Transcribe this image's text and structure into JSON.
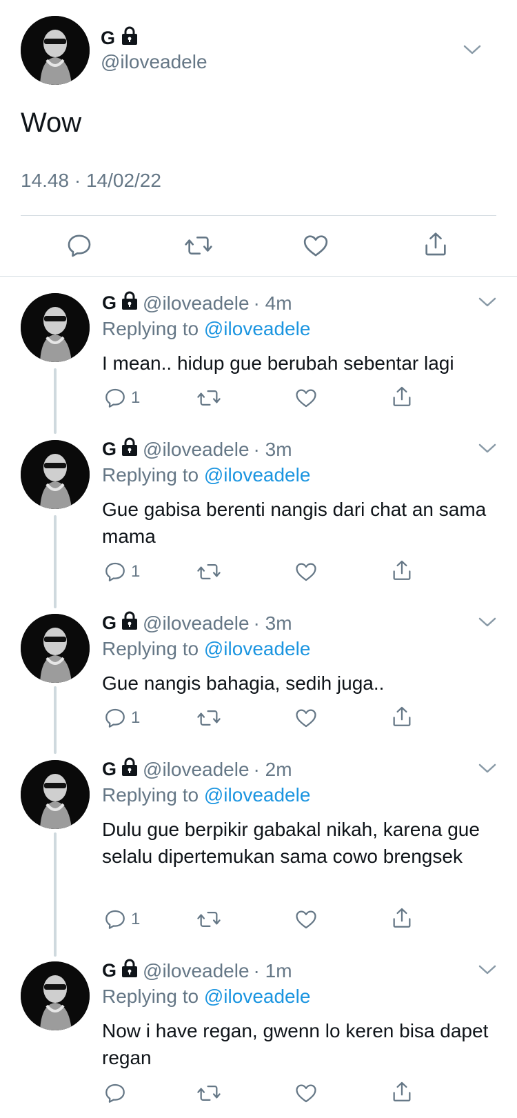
{
  "main_tweet": {
    "name": "G",
    "handle": "@iloveadele",
    "text": "Wow",
    "timestamp": "14.48 · 14/02/22",
    "icons": [
      "reply-icon",
      "retweet-icon",
      "like-icon",
      "share-icon"
    ]
  },
  "replies": [
    {
      "name": "G",
      "handle": "@iloveadele",
      "time": "· 4m",
      "replying_prefix": "Replying to",
      "replying_to": "@iloveadele",
      "text": "I mean.. hidup gue berubah sebentar lagi",
      "reply_count": "1"
    },
    {
      "name": "G",
      "handle": "@iloveadele",
      "time": "· 3m",
      "replying_prefix": "Replying to",
      "replying_to": "@iloveadele",
      "text": "Gue gabisa berenti nangis dari chat an sama mama",
      "reply_count": "1"
    },
    {
      "name": "G",
      "handle": "@iloveadele",
      "time": "· 3m",
      "replying_prefix": "Replying to",
      "replying_to": "@iloveadele",
      "text": "Gue nangis bahagia, sedih juga..",
      "reply_count": "1"
    },
    {
      "name": "G",
      "handle": "@iloveadele",
      "time": "· 2m",
      "replying_prefix": "Replying to",
      "replying_to": "@iloveadele",
      "text": "Dulu gue berpikir gabakal nikah, karena gue selalu dipertemukan sama cowo brengsek",
      "reply_count": "1"
    },
    {
      "name": "G",
      "handle": "@iloveadele",
      "time": "· 1m",
      "replying_prefix": "Replying to",
      "replying_to": "@iloveadele",
      "text": "Now i have regan, gwenn lo keren bisa dapet regan",
      "reply_count": ""
    }
  ],
  "colors": {
    "text": "#0f1419",
    "muted": "#657786",
    "link": "#1b95e0",
    "divider": "#d6dde3",
    "thread_line": "#cfd9de"
  }
}
